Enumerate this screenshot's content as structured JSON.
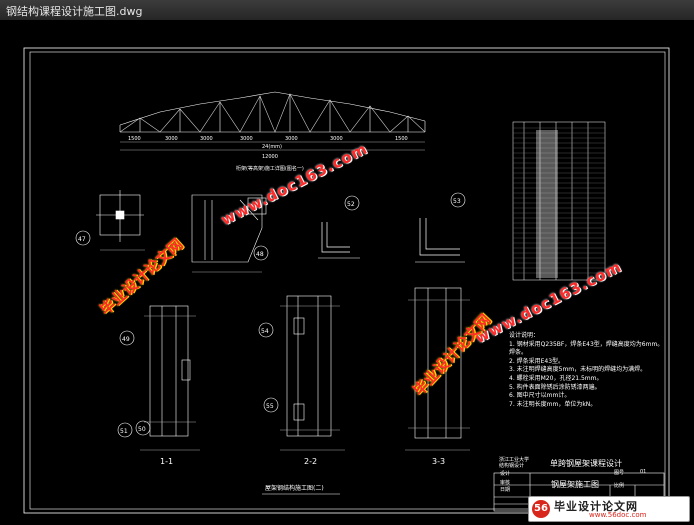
{
  "window": {
    "title": "钢结构课程设计施工图.dwg"
  },
  "drawing": {
    "truss_caption": "桁架(等高架)施工详图(图名一)",
    "truss_dims": [
      "1500",
      "3000",
      "3000",
      "3000",
      "3000",
      "3000",
      "1500"
    ],
    "truss_span": "24(mm)",
    "truss_total": "12000",
    "section_labels": [
      "1-1",
      "2-2",
      "3-3"
    ],
    "bubbles": [
      "47",
      "48",
      "52",
      "53",
      "49",
      "51",
      "50",
      "54",
      "55"
    ],
    "sheet_caption": "屋架钢结构施工图(二)"
  },
  "notes": {
    "heading": "设计说明：",
    "lines": [
      "1. 钢材采用Q235BF，焊条E43型，焊缝高度均为6mm。",
      "   焊条。",
      "2. 焊条采用E43型。",
      "3. 未注明焊缝高度5mm，未标明的焊缝均为满焊。",
      "4. 螺栓采用M20，孔径21.5mm。",
      "5. 构件表面除锈后涂防锈漆两遍。",
      "6. 图中尺寸以mm计。",
      "7. 未注明长度mm，单位为kN。"
    ]
  },
  "title_block": {
    "school": "浙江工业大学结构钢设计",
    "project": "单跨钢屋架课程设计",
    "drawing_name": "钢屋架施工图",
    "rows": [
      "设计",
      "审核",
      "日期"
    ],
    "sheet_label": "图号",
    "sheet_no": "01",
    "scale_label": "比例"
  },
  "watermarks": {
    "url": "www.doc163.com",
    "cn": "毕业设计论文网"
  },
  "brand": {
    "name": "毕业设计论文网",
    "url": "www.56doc.com",
    "logo": "56"
  }
}
